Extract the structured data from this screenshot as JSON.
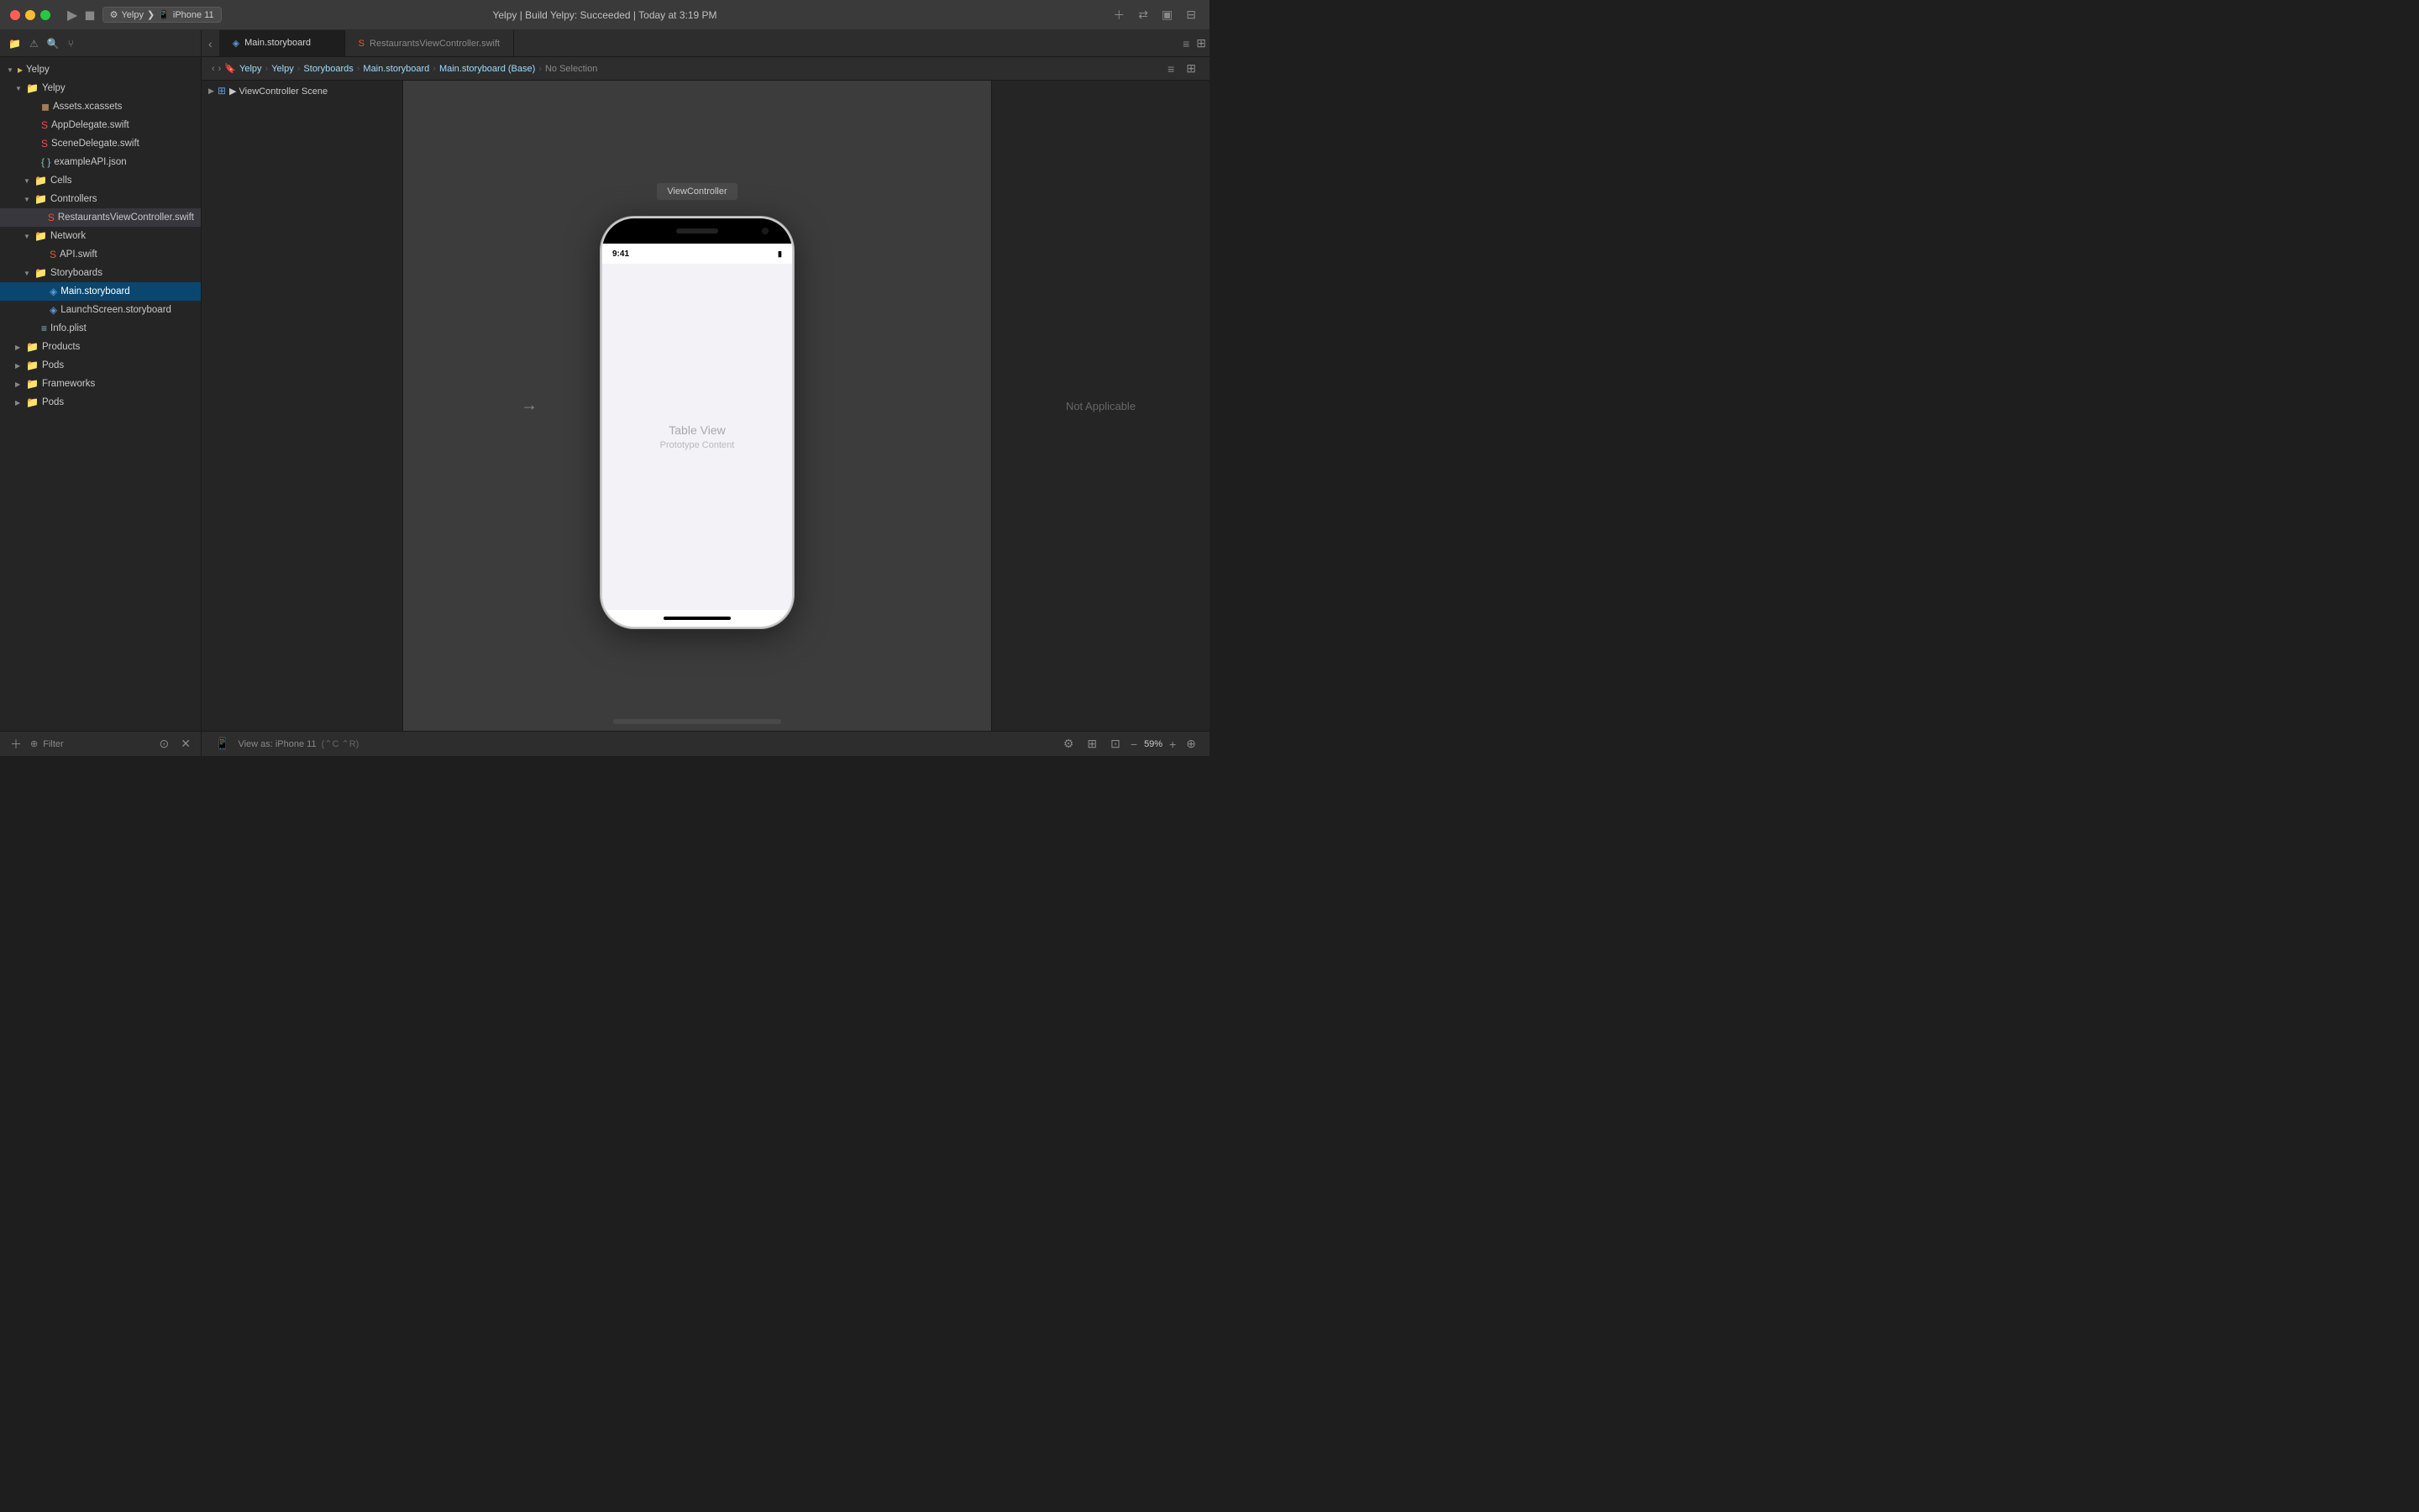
{
  "app": {
    "title": "Yelpy | Build Yelpy: Succeeded | Today at 3:19 PM"
  },
  "titlebar": {
    "scheme": "Yelpy",
    "device": "iPhone 11",
    "play_label": "▶",
    "stop_label": "◼"
  },
  "tabs": [
    {
      "label": "Main.storyboard",
      "active": true
    },
    {
      "label": "RestaurantsViewController.swift",
      "active": false
    }
  ],
  "breadcrumb": {
    "items": [
      "Yelpy",
      "Yelpy",
      "Storyboards",
      "Main.storyboard",
      "Main.storyboard (Base)",
      "No Selection"
    ],
    "nav_back": "‹",
    "nav_forward": "›"
  },
  "scene_list": {
    "header": "▶  ViewController Scene",
    "items": [
      {
        "label": "ViewController Scene",
        "expanded": true
      }
    ]
  },
  "canvas": {
    "vc_label": "ViewController",
    "table_view_label": "Table View",
    "prototype_content_label": "Prototype Content",
    "time": "9:41"
  },
  "right_panel": {
    "not_applicable_label": "Not Applicable"
  },
  "file_tree": {
    "root": {
      "name": "Yelpy",
      "expanded": true,
      "children": [
        {
          "name": "Yelpy",
          "type": "folder",
          "expanded": true,
          "children": [
            {
              "name": "Assets.xcassets",
              "type": "xcassets"
            },
            {
              "name": "AppDelegate.swift",
              "type": "swift"
            },
            {
              "name": "SceneDelegate.swift",
              "type": "swift"
            },
            {
              "name": "exampleAPI.json",
              "type": "json"
            },
            {
              "name": "Cells",
              "type": "folder",
              "expanded": true,
              "children": []
            },
            {
              "name": "Controllers",
              "type": "folder",
              "expanded": true,
              "children": [
                {
                  "name": "RestaurantsViewController.swift",
                  "type": "swift",
                  "selected": false,
                  "highlighted": true
                }
              ]
            },
            {
              "name": "Network",
              "type": "folder",
              "expanded": true,
              "children": [
                {
                  "name": "API.swift",
                  "type": "swift"
                }
              ]
            },
            {
              "name": "Storyboards",
              "type": "folder",
              "expanded": true,
              "children": [
                {
                  "name": "Main.storyboard",
                  "type": "storyboard",
                  "selected": true
                },
                {
                  "name": "LaunchScreen.storyboard",
                  "type": "storyboard"
                }
              ]
            },
            {
              "name": "Info.plist",
              "type": "plist"
            }
          ]
        },
        {
          "name": "Products",
          "type": "folder",
          "expanded": false,
          "children": []
        },
        {
          "name": "Pods",
          "type": "folder",
          "expanded": false,
          "children": []
        },
        {
          "name": "Frameworks",
          "type": "folder",
          "expanded": false,
          "children": []
        },
        {
          "name": "Pods",
          "type": "folder",
          "expanded": false,
          "children": []
        }
      ]
    }
  },
  "bottom_bar": {
    "view_as_label": "View as: iPhone 11",
    "shortcut_label": "(⌃C ⌃R)",
    "zoom_minus": "−",
    "zoom_value": "59%",
    "zoom_plus": "+"
  },
  "sidebar_bottom": {
    "filter_placeholder": "Filter",
    "filter_label": "Filter"
  }
}
